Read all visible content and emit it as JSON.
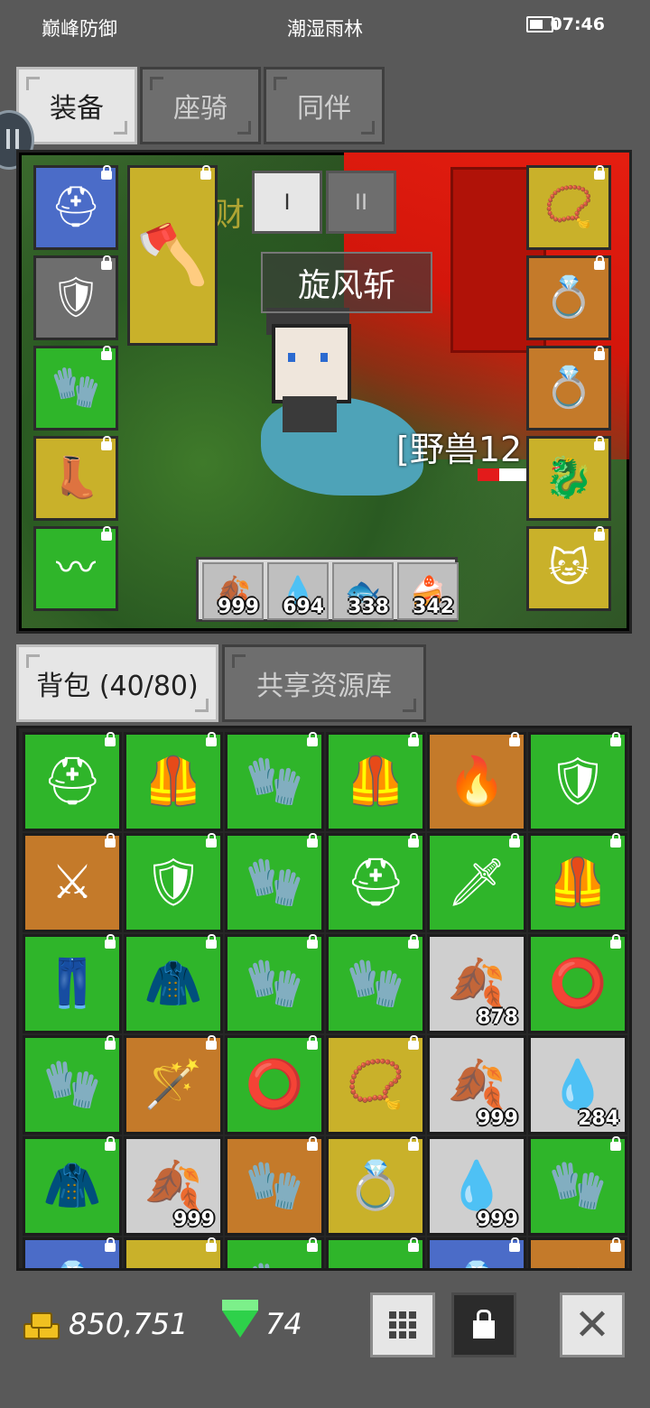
{
  "status": {
    "left": "巅峰防御",
    "center": "潮湿雨林",
    "time": "07:46"
  },
  "top_tabs": [
    {
      "label": "装备",
      "active": true
    },
    {
      "label": "座骑",
      "active": false
    },
    {
      "label": "同伴",
      "active": false
    }
  ],
  "equip_left": [
    {
      "icon": "helmet-icon",
      "glyph": "⛑",
      "color": "blue"
    },
    {
      "icon": "chest-armor-icon",
      "glyph": "🛡",
      "color": "gray"
    },
    {
      "icon": "glove-icon",
      "glyph": "🧤",
      "color": "green"
    },
    {
      "icon": "boots-icon",
      "glyph": "👢",
      "color": "yellow"
    },
    {
      "icon": "belt-icon",
      "glyph": "〰",
      "color": "green"
    }
  ],
  "weapon_slot": {
    "icon": "axe-icon",
    "glyph": "🪓"
  },
  "equip_right": [
    {
      "icon": "necklace-icon",
      "glyph": "📿",
      "color": "yellow"
    },
    {
      "icon": "ring-icon",
      "glyph": "💍",
      "color": "orange"
    },
    {
      "icon": "ring-icon",
      "glyph": "💍",
      "color": "orange"
    },
    {
      "icon": "mount-card-icon",
      "glyph": "🐉",
      "color": "yellow"
    },
    {
      "icon": "pet-cat-icon",
      "glyph": "🐱",
      "color": "yellow"
    }
  ],
  "mode_buttons": [
    "I",
    "II"
  ],
  "skill_name": "旋风斩",
  "enemy_name": "[野兽12",
  "gold_overlay": "招财",
  "quickbar": [
    {
      "icon": "red-leaf-icon",
      "glyph": "🍂",
      "count": "999"
    },
    {
      "icon": "blue-leaf-icon",
      "glyph": "💧",
      "count": "694"
    },
    {
      "icon": "fish-icon",
      "glyph": "🐟",
      "count": "338"
    },
    {
      "icon": "cake-icon",
      "glyph": "🍰",
      "count": "342"
    }
  ],
  "bag_tabs": [
    {
      "label": "背包 (40/80)",
      "active": true
    },
    {
      "label": "共享资源库",
      "active": false
    }
  ],
  "inventory": [
    {
      "icon": "helmet-icon",
      "glyph": "⛑",
      "color": "green",
      "count": ""
    },
    {
      "icon": "chest-armor-icon",
      "glyph": "🦺",
      "color": "green",
      "count": ""
    },
    {
      "icon": "glove-icon",
      "glyph": "🧤",
      "color": "green",
      "count": ""
    },
    {
      "icon": "chest-armor-icon",
      "glyph": "🦺",
      "color": "green",
      "count": ""
    },
    {
      "icon": "chest-armor-icon",
      "glyph": "🔥",
      "color": "orange",
      "count": ""
    },
    {
      "icon": "chest-armor-icon",
      "glyph": "🛡",
      "color": "green",
      "count": ""
    },
    {
      "icon": "scythe-icon",
      "glyph": "⚔",
      "color": "orange",
      "count": ""
    },
    {
      "icon": "chest-armor-icon",
      "glyph": "🛡",
      "color": "green",
      "count": ""
    },
    {
      "icon": "glove-icon",
      "glyph": "🧤",
      "color": "green",
      "count": ""
    },
    {
      "icon": "helmet-icon",
      "glyph": "⛑",
      "color": "green",
      "count": ""
    },
    {
      "icon": "sword-icon",
      "glyph": "🗡",
      "color": "green",
      "count": ""
    },
    {
      "icon": "chest-armor-icon",
      "glyph": "🦺",
      "color": "green",
      "count": ""
    },
    {
      "icon": "pants-icon",
      "glyph": "👖",
      "color": "green",
      "count": ""
    },
    {
      "icon": "chest-armor-icon",
      "glyph": "🧥",
      "color": "green",
      "count": ""
    },
    {
      "icon": "glove-icon",
      "glyph": "🧤",
      "color": "green",
      "count": ""
    },
    {
      "icon": "glove-icon",
      "glyph": "🧤",
      "color": "green",
      "count": ""
    },
    {
      "icon": "red-leaf-icon",
      "glyph": "🍂",
      "color": "light",
      "count": "878"
    },
    {
      "icon": "belt-icon",
      "glyph": "⭕",
      "color": "green",
      "count": ""
    },
    {
      "icon": "glove-icon",
      "glyph": "🧤",
      "color": "green",
      "count": ""
    },
    {
      "icon": "staff-icon",
      "glyph": "🪄",
      "color": "orange",
      "count": ""
    },
    {
      "icon": "belt-icon",
      "glyph": "⭕",
      "color": "green",
      "count": ""
    },
    {
      "icon": "necklace-icon",
      "glyph": "📿",
      "color": "yellow",
      "count": ""
    },
    {
      "icon": "red-leaf-icon",
      "glyph": "🍂",
      "color": "light",
      "count": "999"
    },
    {
      "icon": "blue-leaf-icon",
      "glyph": "💧",
      "color": "light",
      "count": "284"
    },
    {
      "icon": "chest-armor-icon",
      "glyph": "🧥",
      "color": "green",
      "count": ""
    },
    {
      "icon": "red-leaf-icon",
      "glyph": "🍂",
      "color": "light",
      "count": "999"
    },
    {
      "icon": "glove-icon",
      "glyph": "🧤",
      "color": "orange",
      "count": ""
    },
    {
      "icon": "ring-icon",
      "glyph": "💍",
      "color": "yellow",
      "count": ""
    },
    {
      "icon": "blue-leaf-icon",
      "glyph": "💧",
      "color": "light",
      "count": "999"
    },
    {
      "icon": "glove-icon",
      "glyph": "🧤",
      "color": "green",
      "count": ""
    },
    {
      "icon": "ring-icon",
      "glyph": "💍",
      "color": "blue",
      "count": ""
    },
    {
      "icon": "weapon-icon",
      "glyph": "⚔",
      "color": "yellow",
      "count": ""
    },
    {
      "icon": "glove-icon",
      "glyph": "🧤",
      "color": "green",
      "count": ""
    },
    {
      "icon": "item-icon",
      "glyph": "▪",
      "color": "green",
      "count": ""
    },
    {
      "icon": "ring-icon",
      "glyph": "💍",
      "color": "blue",
      "count": ""
    },
    {
      "icon": "item-icon",
      "glyph": "✦",
      "color": "orange",
      "count": ""
    }
  ],
  "footer": {
    "gold": "850,751",
    "gems": "74"
  },
  "colors": {
    "green": "#2fb52a",
    "yellow": "#c9b12a",
    "orange": "#c47a2a",
    "blue": "#4b6cc8",
    "gray": "#6e6e6e",
    "light": "#cfcfcf"
  }
}
